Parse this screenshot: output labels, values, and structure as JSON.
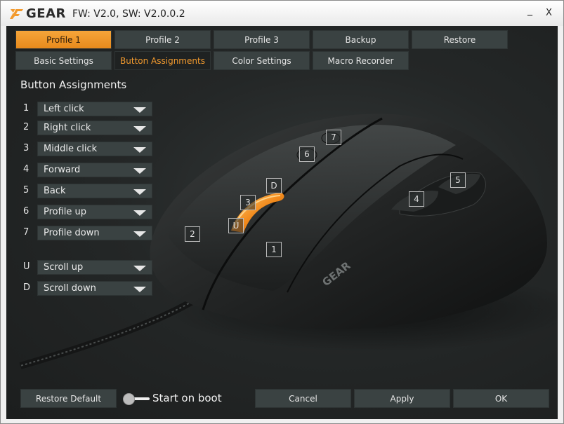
{
  "window": {
    "brand": "GEAR",
    "version": "FW: V2.0, SW: V2.0.0.2",
    "minimize": "_",
    "close": "X"
  },
  "profile_tabs": [
    "Profile 1",
    "Profile 2",
    "Profile 3",
    "Backup",
    "Restore"
  ],
  "active_profile": "Profile 1",
  "section_tabs": [
    "Basic Settings",
    "Button Assignments",
    "Color Settings",
    "Macro Recorder"
  ],
  "active_section": "Button Assignments",
  "section_title": "Button Assignments",
  "assignments": [
    {
      "id": "1",
      "value": "Left click"
    },
    {
      "id": "2",
      "value": "Right click"
    },
    {
      "id": "3",
      "value": "Middle click"
    },
    {
      "id": "4",
      "value": "Forward"
    },
    {
      "id": "5",
      "value": "Back"
    },
    {
      "id": "6",
      "value": "Profile up"
    },
    {
      "id": "7",
      "value": "Profile down"
    },
    {
      "id": "U",
      "value": "Scroll up"
    },
    {
      "id": "D",
      "value": "Scroll down"
    }
  ],
  "mouse": {
    "brand_mark": "GEAR",
    "badges": [
      "1",
      "2",
      "3",
      "4",
      "5",
      "6",
      "7",
      "U",
      "D"
    ],
    "accent_color": "#f28a1c"
  },
  "bottom": {
    "restore_default": "Restore Default",
    "start_on_boot": "Start on boot",
    "start_on_boot_enabled": false,
    "cancel": "Cancel",
    "apply": "Apply",
    "ok": "OK"
  },
  "colors": {
    "accent": "#f29a2e",
    "button_bg": "#3a4242",
    "panel_bg": "#242727"
  }
}
